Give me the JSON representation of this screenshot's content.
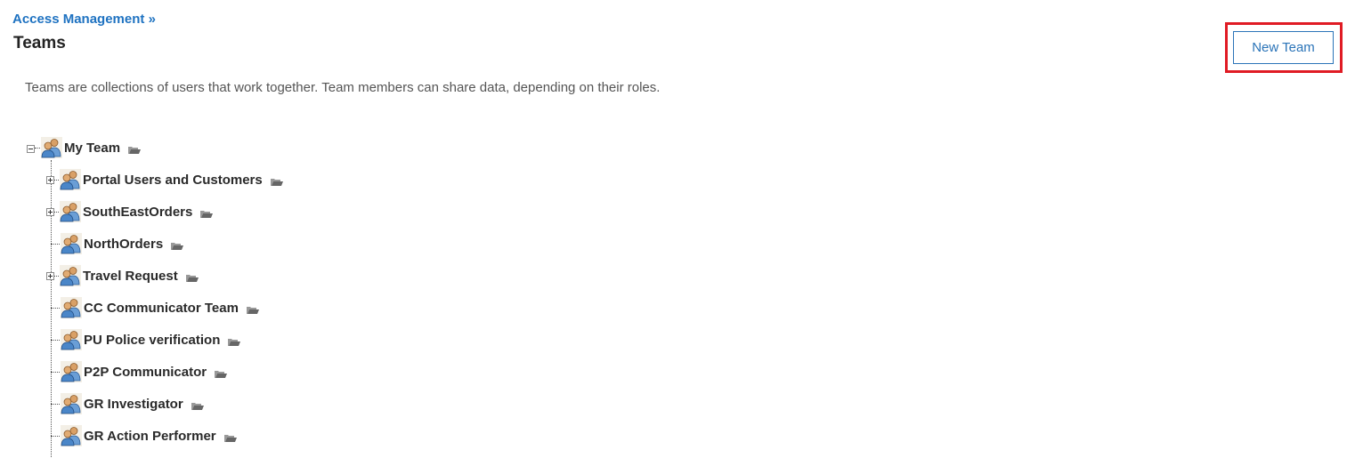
{
  "breadcrumb": {
    "label": "Access Management »"
  },
  "page": {
    "title": "Teams",
    "description": "Teams are collections of users that work together. Team members can share data, depending on their roles."
  },
  "toolbar": {
    "new_team_label": "New Team"
  },
  "tree": {
    "root": {
      "label": "My Team",
      "expanded": true,
      "icon": "team-icon"
    },
    "children": [
      {
        "label": "Portal Users and Customers",
        "has_children": true
      },
      {
        "label": "SouthEastOrders",
        "has_children": true
      },
      {
        "label": "NorthOrders",
        "has_children": false
      },
      {
        "label": "Travel Request",
        "has_children": true
      },
      {
        "label": "CC Communicator Team",
        "has_children": false
      },
      {
        "label": "PU Police verification",
        "has_children": false
      },
      {
        "label": "P2P Communicator",
        "has_children": false
      },
      {
        "label": "GR Investigator",
        "has_children": false
      },
      {
        "label": "GR Action Performer",
        "has_children": false
      }
    ]
  },
  "colors": {
    "link": "#1e72c1",
    "button_border": "#2b74b8",
    "highlight": "#e01b24"
  }
}
